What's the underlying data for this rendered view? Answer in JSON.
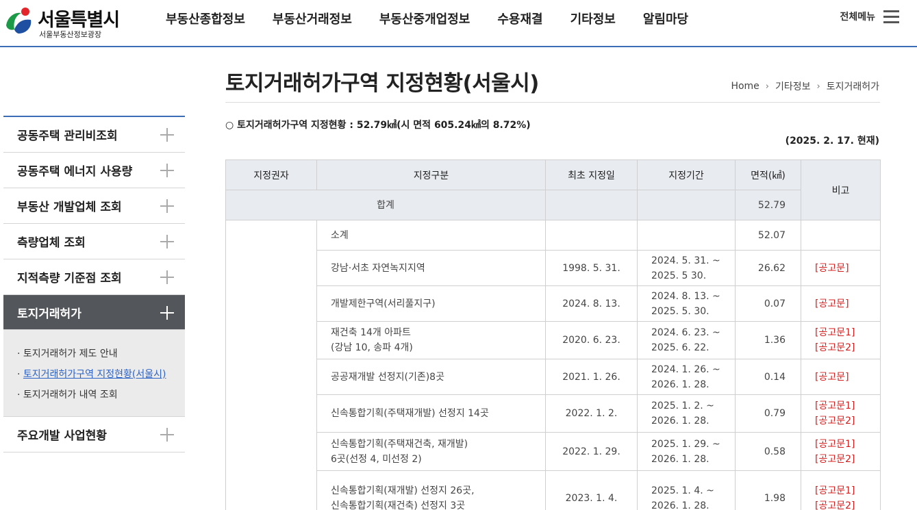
{
  "header": {
    "logo_title": "서울특별시",
    "logo_sub": "서울부동산정보광장",
    "nav": [
      "부동산종합정보",
      "부동산거래정보",
      "부동산중개업정보",
      "수용재결",
      "기타정보",
      "알림마당"
    ],
    "all_menu": "전체메뉴"
  },
  "sidebar": {
    "items_before": [
      "공동주택 관리비조회",
      "공동주택 에너지 사용량",
      "부동산 개발업체 조회",
      "측량업체 조회",
      "지적측량 기준점 조회"
    ],
    "active": "토지거래허가",
    "sub_items": [
      "· 토지거래허가 제도 안내",
      "토지거래허가구역 지정현황(서울시)",
      "· 토지거래허가 내역 조회"
    ],
    "sub_current_bullet": "· ",
    "items_after": [
      "주요개발 사업현황"
    ]
  },
  "main": {
    "title": "토지거래허가구역 지정현황(서울시)",
    "breadcrumb": [
      "Home",
      "기타정보",
      "토지거래허가"
    ],
    "breadcrumb_sep": "›",
    "summary": "○ 토지거래허가구역 지정현황 : 52.79㎢(시 면적 605.24㎢의 8.72%)",
    "as_of": "(2025. 2. 17. 현재)"
  },
  "table": {
    "headers": [
      "지정권자",
      "지정구분",
      "최초 지정일",
      "지정기간",
      "면적(㎢)",
      "비고"
    ],
    "total_label": "합계",
    "total_area": "52.79",
    "subtotal_label": "소계",
    "subtotal_area": "52.07",
    "rows": [
      {
        "lines": [
          "강남·서초 자연녹지지역"
        ],
        "first": "1998. 5. 31.",
        "period": [
          "2024. 5. 31. ~",
          "2025. 5 30."
        ],
        "area": "26.62",
        "links": [
          "[공고문]"
        ]
      },
      {
        "lines": [
          "개발제한구역(서리풀지구)"
        ],
        "first": "2024. 8. 13.",
        "period": [
          "2024. 8. 13. ~",
          "2025. 5. 30."
        ],
        "area": "0.07",
        "links": [
          "[공고문]"
        ]
      },
      {
        "lines": [
          "재건축 14개 아파트",
          "(강남 10, 송파 4개)"
        ],
        "first": "2020. 6. 23.",
        "period": [
          "2024. 6. 23. ~",
          "2025. 6. 22."
        ],
        "area": "1.36",
        "links": [
          "[공고문1]",
          "[공고문2]"
        ]
      },
      {
        "lines": [
          "공공재개발 선정지(기존)8곳"
        ],
        "first": "2021. 1. 26.",
        "period": [
          "2024. 1. 26. ~",
          "2026. 1. 28."
        ],
        "area": "0.14",
        "links": [
          "[공고문]"
        ]
      },
      {
        "lines": [
          "신속통합기획(주택재개발) 선정지 14곳"
        ],
        "first": "2022. 1. 2.",
        "period": [
          "2025. 1. 2. ~",
          "2026. 1. 28."
        ],
        "area": "0.79",
        "links": [
          "[공고문1]",
          "[공고문2]"
        ]
      },
      {
        "lines": [
          "신속통합기획(주택재건축, 재개발)",
          "6곳(선정 4, 미선정 2)"
        ],
        "first": "2022. 1. 29.",
        "period": [
          "2025. 1. 29. ~",
          "2026. 1. 28."
        ],
        "area": "0.58",
        "links": [
          "[공고문1]",
          "[공고문2]"
        ]
      },
      {
        "lines": [
          "신속통합기획(재개발) 선정지 26곳,",
          "신속통합기획(재건축) 선정지 3곳"
        ],
        "first": "2023. 1. 4.",
        "period": [
          "2025. 1. 4. ~",
          "2026. 1. 28."
        ],
        "area": "1.98",
        "links": [
          "[공고문1]",
          "[공고문2]"
        ]
      }
    ]
  },
  "colors": {
    "accent": "#3a6db5",
    "active_menu": "#53575c",
    "link_red": "#d41c1c",
    "header_bg": "#e8ebef"
  }
}
